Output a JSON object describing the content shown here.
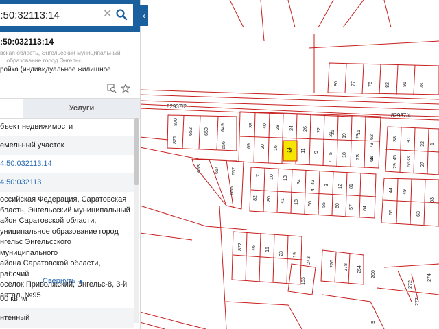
{
  "search": {
    "value": "4:50:32113:14",
    "clear_icon": "close-icon",
    "search_icon": "search-icon"
  },
  "panel": {
    "title": ":50:032113:14",
    "subtitle": "вская область, Энгельсский муниципальный ... образование город Энгельс...",
    "usage": "ройка (индивидуальное жилищное",
    "tabs": {
      "services": "Услуги"
    },
    "rows": {
      "type": "бъект недвижимости",
      "kind": "емельный участок",
      "cad_num": "4:50:032113:14",
      "quarter": "4:50:032113",
      "area": "00 кв. м",
      "status": "нтенный"
    },
    "address_lines": [
      "оссийская Федерация, Саратовская",
      "бласть, Энгельсский муниципальный",
      "айон Саратовской области,",
      "униципальное образование город",
      "нгельс Энгельсского муниципального",
      "айона Саратовской области, рабочий",
      "оселок Приволжский, Энгельс-8, 3-й",
      "артал, №95"
    ],
    "collapse_link": "Свернуть"
  },
  "map": {
    "line_color": "#c81e1e",
    "highlight_color": "#f5e600",
    "road_labels": [
      "82937/2",
      "82937/4"
    ],
    "parcel_labels": {
      "top_row": [
        "80",
        "77",
        "76",
        "82",
        "91",
        "78"
      ],
      "left_block": [
        "870",
        "652",
        "650",
        "649",
        "871",
        "656",
        "653",
        "654",
        "657",
        "655"
      ],
      "mid_block_a": [
        "39",
        "40",
        "28",
        "24",
        "26",
        "22",
        "25",
        "69",
        "20",
        "16",
        "14",
        "11",
        "9",
        "21",
        "19",
        "23",
        "5",
        "18",
        "3",
        "7",
        "17",
        "15",
        "62",
        "73",
        "71",
        "68"
      ],
      "mid_block_b": [
        "7",
        "10",
        "13",
        "34",
        "42",
        "82",
        "80",
        "41",
        "18",
        "56",
        "55",
        "60",
        "81",
        "57",
        "64",
        "12",
        "3",
        "4"
      ],
      "right_block": [
        "45",
        "33",
        "38",
        "30",
        "32",
        "65",
        "27",
        "29",
        "63",
        "44",
        "49",
        "66",
        "63",
        "1"
      ],
      "south": [
        "872",
        "46",
        "15",
        "23",
        "19",
        "243",
        "163",
        "276",
        "278",
        "254",
        "206",
        "272",
        "272",
        "274",
        "9"
      ]
    }
  }
}
